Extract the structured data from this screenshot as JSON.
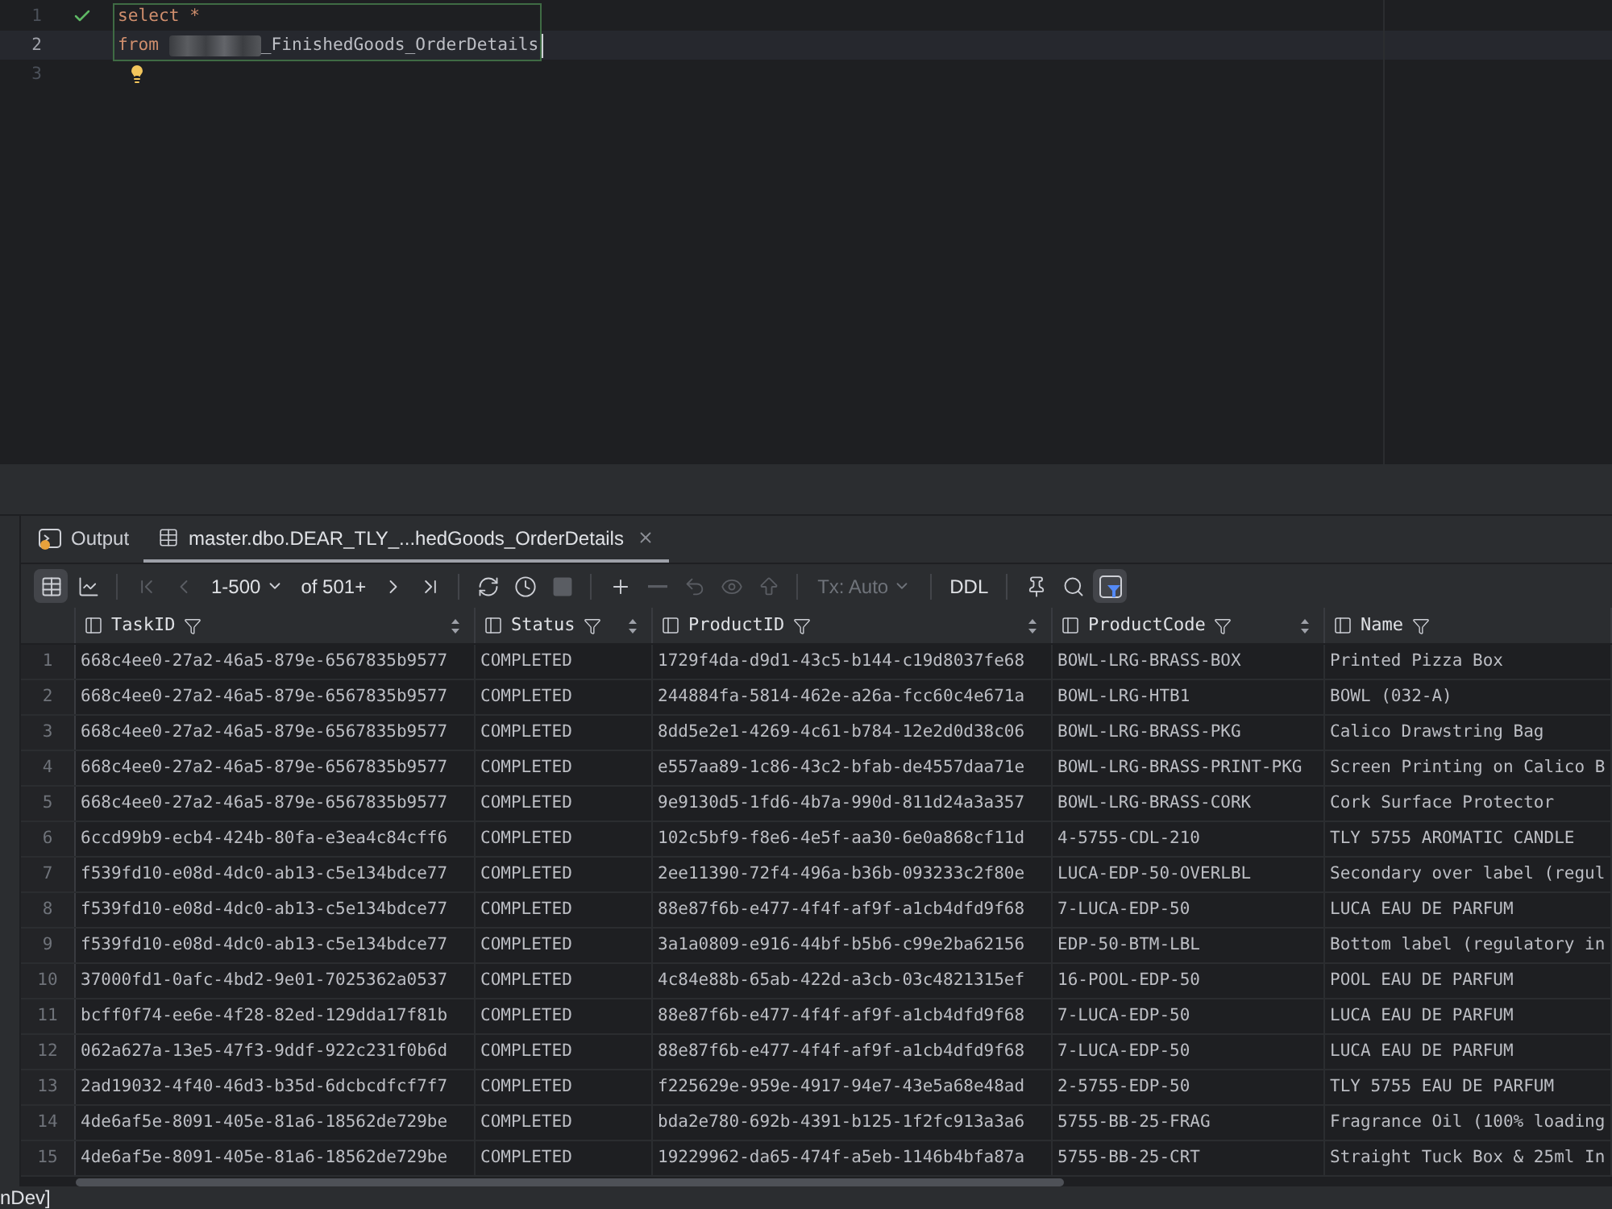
{
  "editor": {
    "lines": [
      {
        "number": "1",
        "executed": true,
        "current": false,
        "in_statement": true,
        "hint": false,
        "caret": false,
        "tokens": [
          {
            "kind": "keyword",
            "text": "select"
          },
          {
            "kind": "operator",
            "text": "*"
          }
        ]
      },
      {
        "number": "2",
        "executed": false,
        "current": true,
        "in_statement": true,
        "hint": false,
        "caret": true,
        "tokens": [
          {
            "kind": "keyword",
            "text": "from"
          },
          {
            "kind": "redacted"
          },
          {
            "kind": "identifier",
            "text": "_FinishedGoods_OrderDetails"
          }
        ]
      },
      {
        "number": "3",
        "executed": false,
        "current": false,
        "in_statement": false,
        "hint": true,
        "caret": false
      }
    ]
  },
  "results_panel": {
    "tabs": [
      {
        "kind": "output",
        "label": "Output",
        "selected": false,
        "closable": false
      },
      {
        "kind": "result",
        "label": "master.dbo.DEAR_TLY_...hedGoods_OrderDetails",
        "selected": true,
        "closable": true
      }
    ],
    "toolbar": {
      "groups": [
        {
          "items": [
            {
              "kind": "toggle",
              "selected": true
            },
            {
              "kind": "toggle",
              "selected": false
            }
          ]
        },
        {
          "items": [
            {
              "kind": "button",
              "disabled": true
            },
            {
              "kind": "button",
              "disabled": true
            },
            {
              "kind": "dropdown",
              "label": "1-500",
              "disabled": false
            },
            {
              "kind": "link",
              "label": "of 501+"
            },
            {
              "kind": "button",
              "disabled": false
            },
            {
              "kind": "button",
              "disabled": false
            }
          ]
        },
        {
          "items": [
            {
              "kind": "button",
              "disabled": false
            },
            {
              "kind": "button",
              "disabled": false
            },
            {
              "kind": "button",
              "disabled": true
            }
          ]
        },
        {
          "items": [
            {
              "kind": "button",
              "disabled": false
            },
            {
              "kind": "button",
              "disabled": true
            },
            {
              "kind": "button",
              "disabled": true
            },
            {
              "kind": "button",
              "disabled": true
            },
            {
              "kind": "button",
              "disabled": true
            }
          ]
        },
        {
          "items": [
            {
              "kind": "dropdown",
              "label": "Tx: Auto",
              "disabled": true
            }
          ]
        },
        {
          "items": [
            {
              "kind": "link",
              "label": "DDL"
            }
          ]
        },
        {
          "items": [
            {
              "kind": "button",
              "disabled": false
            },
            {
              "kind": "button",
              "disabled": false
            },
            {
              "kind": "toggle",
              "selected": true
            }
          ]
        }
      ]
    }
  },
  "table": {
    "columns": [
      {
        "name": "TaskID",
        "sort_control": true
      },
      {
        "name": "Status",
        "sort_control": true
      },
      {
        "name": "ProductID",
        "sort_control": true
      },
      {
        "name": "ProductCode",
        "sort_control": true
      },
      {
        "name": "Name",
        "sort_control": false
      }
    ],
    "rows": [
      {
        "number": "1",
        "cells": [
          "668c4ee0-27a2-46a5-879e-6567835b9577",
          "COMPLETED",
          "1729f4da-d9d1-43c5-b144-c19d8037fe68",
          "BOWL-LRG-BRASS-BOX",
          "Printed Pizza Box"
        ]
      },
      {
        "number": "2",
        "cells": [
          "668c4ee0-27a2-46a5-879e-6567835b9577",
          "COMPLETED",
          "244884fa-5814-462e-a26a-fcc60c4e671a",
          "BOWL-LRG-HTB1",
          "BOWL (032-A)"
        ]
      },
      {
        "number": "3",
        "cells": [
          "668c4ee0-27a2-46a5-879e-6567835b9577",
          "COMPLETED",
          "8dd5e2e1-4269-4c61-b784-12e2d0d38c06",
          "BOWL-LRG-BRASS-PKG",
          "Calico Drawstring Bag"
        ]
      },
      {
        "number": "4",
        "cells": [
          "668c4ee0-27a2-46a5-879e-6567835b9577",
          "COMPLETED",
          "e557aa89-1c86-43c2-bfab-de4557daa71e",
          "BOWL-LRG-BRASS-PRINT-PKG",
          "Screen Printing on Calico B"
        ]
      },
      {
        "number": "5",
        "cells": [
          "668c4ee0-27a2-46a5-879e-6567835b9577",
          "COMPLETED",
          "9e9130d5-1fd6-4b7a-990d-811d24a3a357",
          "BOWL-LRG-BRASS-CORK",
          "Cork Surface Protector"
        ]
      },
      {
        "number": "6",
        "cells": [
          "6ccd99b9-ecb4-424b-80fa-e3ea4c84cff6",
          "COMPLETED",
          "102c5bf9-f8e6-4e5f-aa30-6e0a868cf11d",
          "4-5755-CDL-210",
          "TLY 5755 AROMATIC CANDLE"
        ]
      },
      {
        "number": "7",
        "cells": [
          "f539fd10-e08d-4dc0-ab13-c5e134bdce77",
          "COMPLETED",
          "2ee11390-72f4-496a-b36b-093233c2f80e",
          "LUCA-EDP-50-OVERLBL",
          "Secondary over label (regul"
        ]
      },
      {
        "number": "8",
        "cells": [
          "f539fd10-e08d-4dc0-ab13-c5e134bdce77",
          "COMPLETED",
          "88e87f6b-e477-4f4f-af9f-a1cb4dfd9f68",
          "7-LUCA-EDP-50",
          "LUCA EAU DE PARFUM"
        ]
      },
      {
        "number": "9",
        "cells": [
          "f539fd10-e08d-4dc0-ab13-c5e134bdce77",
          "COMPLETED",
          "3a1a0809-e916-44bf-b5b6-c99e2ba62156",
          "EDP-50-BTM-LBL",
          "Bottom label (regulatory in"
        ]
      },
      {
        "number": "10",
        "cells": [
          "37000fd1-0afc-4bd2-9e01-7025362a0537",
          "COMPLETED",
          "4c84e88b-65ab-422d-a3cb-03c4821315ef",
          "16-POOL-EDP-50",
          "POOL EAU DE PARFUM"
        ]
      },
      {
        "number": "11",
        "cells": [
          "bcff0f74-ee6e-4f28-82ed-129dda17f81b",
          "COMPLETED",
          "88e87f6b-e477-4f4f-af9f-a1cb4dfd9f68",
          "7-LUCA-EDP-50",
          "LUCA EAU DE PARFUM"
        ]
      },
      {
        "number": "12",
        "cells": [
          "062a627a-13e5-47f3-9ddf-922c231f0b6d",
          "COMPLETED",
          "88e87f6b-e477-4f4f-af9f-a1cb4dfd9f68",
          "7-LUCA-EDP-50",
          "LUCA EAU DE PARFUM"
        ]
      },
      {
        "number": "13",
        "cells": [
          "2ad19032-4f40-46d3-b35d-6dcbcdfcf7f7",
          "COMPLETED",
          "f225629e-959e-4917-94e7-43e5a68e48ad",
          "2-5755-EDP-50",
          "TLY 5755 EAU DE PARFUM"
        ]
      },
      {
        "number": "14",
        "cells": [
          "4de6af5e-8091-405e-81a6-18562de729be",
          "COMPLETED",
          "bda2e780-692b-4391-b125-1f2fc913a3a6",
          "5755-BB-25-FRAG",
          "Fragrance Oil (100% loading"
        ]
      },
      {
        "number": "15",
        "cells": [
          "4de6af5e-8091-405e-81a6-18562de729be",
          "COMPLETED",
          "19229962-da65-474f-a5eb-1146b4bfa87a",
          "5755-BB-25-CRT",
          "Straight Tuck Box & 25ml In"
        ]
      }
    ]
  },
  "status_bar": {
    "text": "nDev]"
  }
}
